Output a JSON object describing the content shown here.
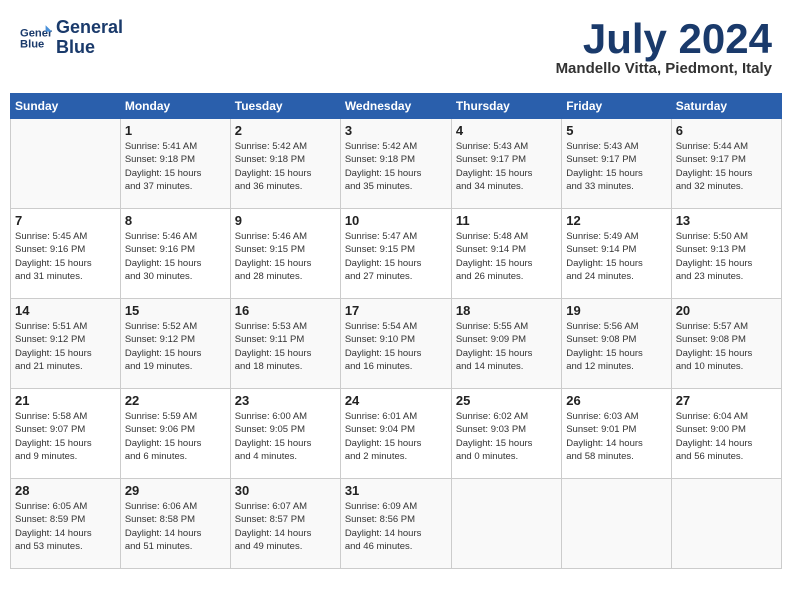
{
  "header": {
    "logo_line1": "General",
    "logo_line2": "Blue",
    "month": "July 2024",
    "location": "Mandello Vitta, Piedmont, Italy"
  },
  "days_of_week": [
    "Sunday",
    "Monday",
    "Tuesday",
    "Wednesday",
    "Thursday",
    "Friday",
    "Saturday"
  ],
  "weeks": [
    [
      {
        "day": "",
        "info": ""
      },
      {
        "day": "1",
        "info": "Sunrise: 5:41 AM\nSunset: 9:18 PM\nDaylight: 15 hours\nand 37 minutes."
      },
      {
        "day": "2",
        "info": "Sunrise: 5:42 AM\nSunset: 9:18 PM\nDaylight: 15 hours\nand 36 minutes."
      },
      {
        "day": "3",
        "info": "Sunrise: 5:42 AM\nSunset: 9:18 PM\nDaylight: 15 hours\nand 35 minutes."
      },
      {
        "day": "4",
        "info": "Sunrise: 5:43 AM\nSunset: 9:17 PM\nDaylight: 15 hours\nand 34 minutes."
      },
      {
        "day": "5",
        "info": "Sunrise: 5:43 AM\nSunset: 9:17 PM\nDaylight: 15 hours\nand 33 minutes."
      },
      {
        "day": "6",
        "info": "Sunrise: 5:44 AM\nSunset: 9:17 PM\nDaylight: 15 hours\nand 32 minutes."
      }
    ],
    [
      {
        "day": "7",
        "info": "Sunrise: 5:45 AM\nSunset: 9:16 PM\nDaylight: 15 hours\nand 31 minutes."
      },
      {
        "day": "8",
        "info": "Sunrise: 5:46 AM\nSunset: 9:16 PM\nDaylight: 15 hours\nand 30 minutes."
      },
      {
        "day": "9",
        "info": "Sunrise: 5:46 AM\nSunset: 9:15 PM\nDaylight: 15 hours\nand 28 minutes."
      },
      {
        "day": "10",
        "info": "Sunrise: 5:47 AM\nSunset: 9:15 PM\nDaylight: 15 hours\nand 27 minutes."
      },
      {
        "day": "11",
        "info": "Sunrise: 5:48 AM\nSunset: 9:14 PM\nDaylight: 15 hours\nand 26 minutes."
      },
      {
        "day": "12",
        "info": "Sunrise: 5:49 AM\nSunset: 9:14 PM\nDaylight: 15 hours\nand 24 minutes."
      },
      {
        "day": "13",
        "info": "Sunrise: 5:50 AM\nSunset: 9:13 PM\nDaylight: 15 hours\nand 23 minutes."
      }
    ],
    [
      {
        "day": "14",
        "info": "Sunrise: 5:51 AM\nSunset: 9:12 PM\nDaylight: 15 hours\nand 21 minutes."
      },
      {
        "day": "15",
        "info": "Sunrise: 5:52 AM\nSunset: 9:12 PM\nDaylight: 15 hours\nand 19 minutes."
      },
      {
        "day": "16",
        "info": "Sunrise: 5:53 AM\nSunset: 9:11 PM\nDaylight: 15 hours\nand 18 minutes."
      },
      {
        "day": "17",
        "info": "Sunrise: 5:54 AM\nSunset: 9:10 PM\nDaylight: 15 hours\nand 16 minutes."
      },
      {
        "day": "18",
        "info": "Sunrise: 5:55 AM\nSunset: 9:09 PM\nDaylight: 15 hours\nand 14 minutes."
      },
      {
        "day": "19",
        "info": "Sunrise: 5:56 AM\nSunset: 9:08 PM\nDaylight: 15 hours\nand 12 minutes."
      },
      {
        "day": "20",
        "info": "Sunrise: 5:57 AM\nSunset: 9:08 PM\nDaylight: 15 hours\nand 10 minutes."
      }
    ],
    [
      {
        "day": "21",
        "info": "Sunrise: 5:58 AM\nSunset: 9:07 PM\nDaylight: 15 hours\nand 9 minutes."
      },
      {
        "day": "22",
        "info": "Sunrise: 5:59 AM\nSunset: 9:06 PM\nDaylight: 15 hours\nand 6 minutes."
      },
      {
        "day": "23",
        "info": "Sunrise: 6:00 AM\nSunset: 9:05 PM\nDaylight: 15 hours\nand 4 minutes."
      },
      {
        "day": "24",
        "info": "Sunrise: 6:01 AM\nSunset: 9:04 PM\nDaylight: 15 hours\nand 2 minutes."
      },
      {
        "day": "25",
        "info": "Sunrise: 6:02 AM\nSunset: 9:03 PM\nDaylight: 15 hours\nand 0 minutes."
      },
      {
        "day": "26",
        "info": "Sunrise: 6:03 AM\nSunset: 9:01 PM\nDaylight: 14 hours\nand 58 minutes."
      },
      {
        "day": "27",
        "info": "Sunrise: 6:04 AM\nSunset: 9:00 PM\nDaylight: 14 hours\nand 56 minutes."
      }
    ],
    [
      {
        "day": "28",
        "info": "Sunrise: 6:05 AM\nSunset: 8:59 PM\nDaylight: 14 hours\nand 53 minutes."
      },
      {
        "day": "29",
        "info": "Sunrise: 6:06 AM\nSunset: 8:58 PM\nDaylight: 14 hours\nand 51 minutes."
      },
      {
        "day": "30",
        "info": "Sunrise: 6:07 AM\nSunset: 8:57 PM\nDaylight: 14 hours\nand 49 minutes."
      },
      {
        "day": "31",
        "info": "Sunrise: 6:09 AM\nSunset: 8:56 PM\nDaylight: 14 hours\nand 46 minutes."
      },
      {
        "day": "",
        "info": ""
      },
      {
        "day": "",
        "info": ""
      },
      {
        "day": "",
        "info": ""
      }
    ]
  ]
}
